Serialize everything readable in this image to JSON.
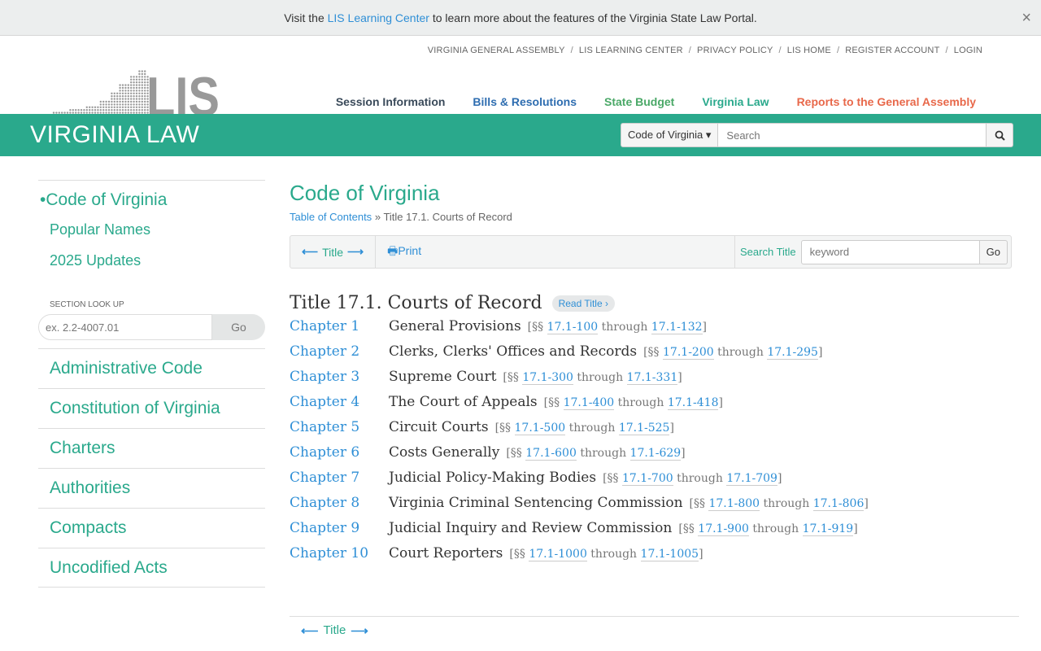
{
  "banner": {
    "pre": "Visit the ",
    "link": "LIS Learning Center",
    "post": " to learn more about the features of the Virginia State Law Portal.",
    "close": "×"
  },
  "logo": {
    "text": "LIS"
  },
  "top_links": [
    "VIRGINIA GENERAL ASSEMBLY",
    "LIS LEARNING CENTER",
    "PRIVACY POLICY",
    "LIS HOME",
    "REGISTER ACCOUNT",
    "LOGIN"
  ],
  "main_nav": [
    {
      "label": "Session Information",
      "color": "#3a4a5a"
    },
    {
      "label": "Bills & Resolutions",
      "color": "#2e6db0"
    },
    {
      "label": "State Budget",
      "color": "#4aa867"
    },
    {
      "label": "Virginia Law",
      "color": "#2aa98c"
    },
    {
      "label": "Reports to the General Assembly",
      "color": "#e8684a"
    }
  ],
  "section_bar": {
    "title": "VIRGINIA LAW",
    "search_scope": "Code of Virginia",
    "search_placeholder": "Search"
  },
  "sidebar": {
    "sub_items": [
      "Code of Virginia",
      "Popular Names",
      "2025 Updates"
    ],
    "lookup_label": "SECTION LOOK UP",
    "lookup_placeholder": "ex. 2.2-4007.01",
    "lookup_go": "Go",
    "items": [
      "Administrative Code",
      "Constitution of Virginia",
      "Charters",
      "Authorities",
      "Compacts",
      "Uncodified Acts"
    ]
  },
  "main": {
    "heading": "Code of Virginia",
    "breadcrumb": {
      "link": "Table of Contents",
      "sep": "»",
      "current": "Title 17.1. Courts of Record"
    },
    "toolbar": {
      "nav_label": "Title",
      "print": "Print",
      "search_label": "Search Title",
      "search_placeholder": "keyword",
      "go": "Go"
    },
    "title": "Title 17.1. Courts of Record",
    "read_title": "Read Title ›",
    "chapters": [
      {
        "num": "Chapter 1",
        "title": "General Provisions",
        "from": "17.1-100",
        "to": "17.1-132"
      },
      {
        "num": "Chapter 2",
        "title": "Clerks, Clerks' Offices and Records",
        "from": "17.1-200",
        "to": "17.1-295"
      },
      {
        "num": "Chapter 3",
        "title": "Supreme Court",
        "from": "17.1-300",
        "to": "17.1-331"
      },
      {
        "num": "Chapter 4",
        "title": "The Court of Appeals",
        "from": "17.1-400",
        "to": "17.1-418"
      },
      {
        "num": "Chapter 5",
        "title": "Circuit Courts",
        "from": "17.1-500",
        "to": "17.1-525"
      },
      {
        "num": "Chapter 6",
        "title": "Costs Generally",
        "from": "17.1-600",
        "to": "17.1-629"
      },
      {
        "num": "Chapter 7",
        "title": "Judicial Policy-Making Bodies",
        "from": "17.1-700",
        "to": "17.1-709"
      },
      {
        "num": "Chapter 8",
        "title": "Virginia Criminal Sentencing Commission",
        "from": "17.1-800",
        "to": "17.1-806"
      },
      {
        "num": "Chapter 9",
        "title": "Judicial Inquiry and Review Commission",
        "from": "17.1-900",
        "to": "17.1-919"
      },
      {
        "num": "Chapter 10",
        "title": "Court Reporters",
        "from": "17.1-1000",
        "to": "17.1-1005"
      }
    ],
    "range_prefix": "[§§ ",
    "range_through": " through ",
    "range_suffix": "]"
  },
  "bottom_nav": {
    "label": "Title"
  }
}
